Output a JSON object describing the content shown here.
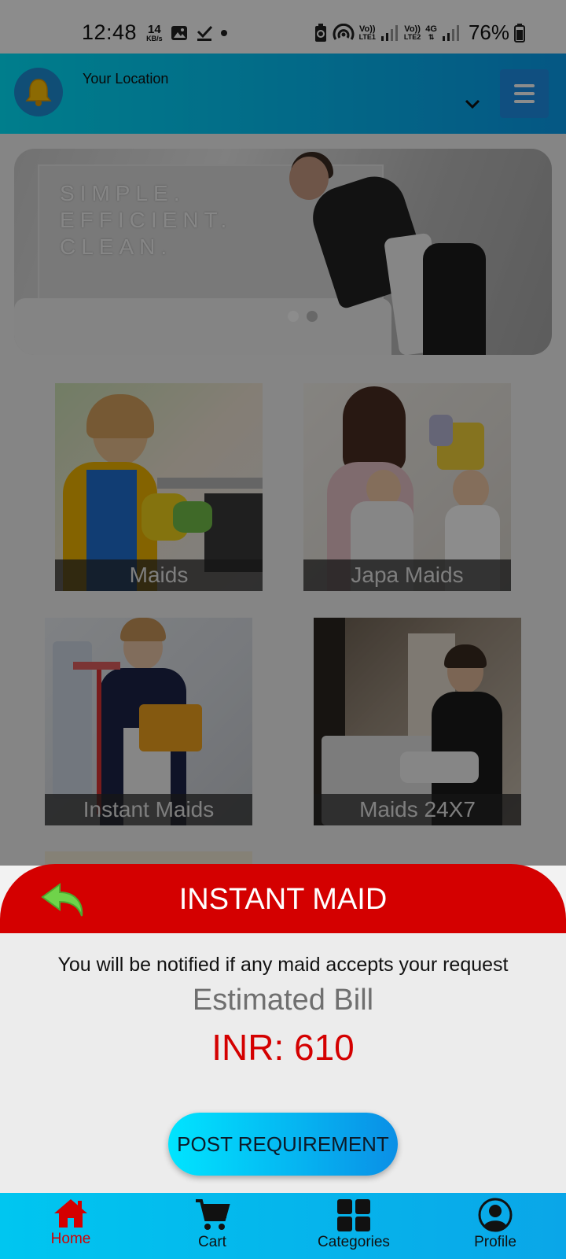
{
  "status_bar": {
    "time": "12:48",
    "net_speed_value": "14",
    "net_speed_unit": "KB/s",
    "sim1_tag": "Vo))",
    "sim1_sub": "LTE1",
    "sim2_tag": "Vo))",
    "sim2_sub": "LTE2",
    "network_type": "4G",
    "battery": "76%"
  },
  "header": {
    "location_label": "Your Location",
    "icons": {
      "notification": "bell-icon",
      "location_dropdown": "chevron-down-icon",
      "menu": "hamburger-menu-icon"
    }
  },
  "banner": {
    "lines": [
      "SIMPLE.",
      "EFFICIENT.",
      "CLEAN."
    ]
  },
  "categories": [
    {
      "label": "Maids"
    },
    {
      "label": "Japa Maids"
    },
    {
      "label": "Instant Maids"
    },
    {
      "label": "Maids 24X7"
    }
  ],
  "sheet": {
    "title": "INSTANT MAID",
    "notify_text": "You will be notified if any maid accepts your request",
    "bill_label": "Estimated Bill",
    "bill_amount": "INR: 610",
    "post_button": "POST REQUIREMENT"
  },
  "bottom_nav": {
    "items": [
      {
        "label": "Home",
        "icon": "home-icon",
        "active": true
      },
      {
        "label": "Cart",
        "icon": "cart-icon",
        "active": false
      },
      {
        "label": "Categories",
        "icon": "grid-icon",
        "active": false
      },
      {
        "label": "Profile",
        "icon": "profile-icon",
        "active": false
      }
    ]
  },
  "colors": {
    "accent_cyan": "#00e5ff",
    "accent_blue": "#0a9ff0",
    "sheet_red": "#d40000",
    "back_icon_green": "#6fd34a"
  }
}
